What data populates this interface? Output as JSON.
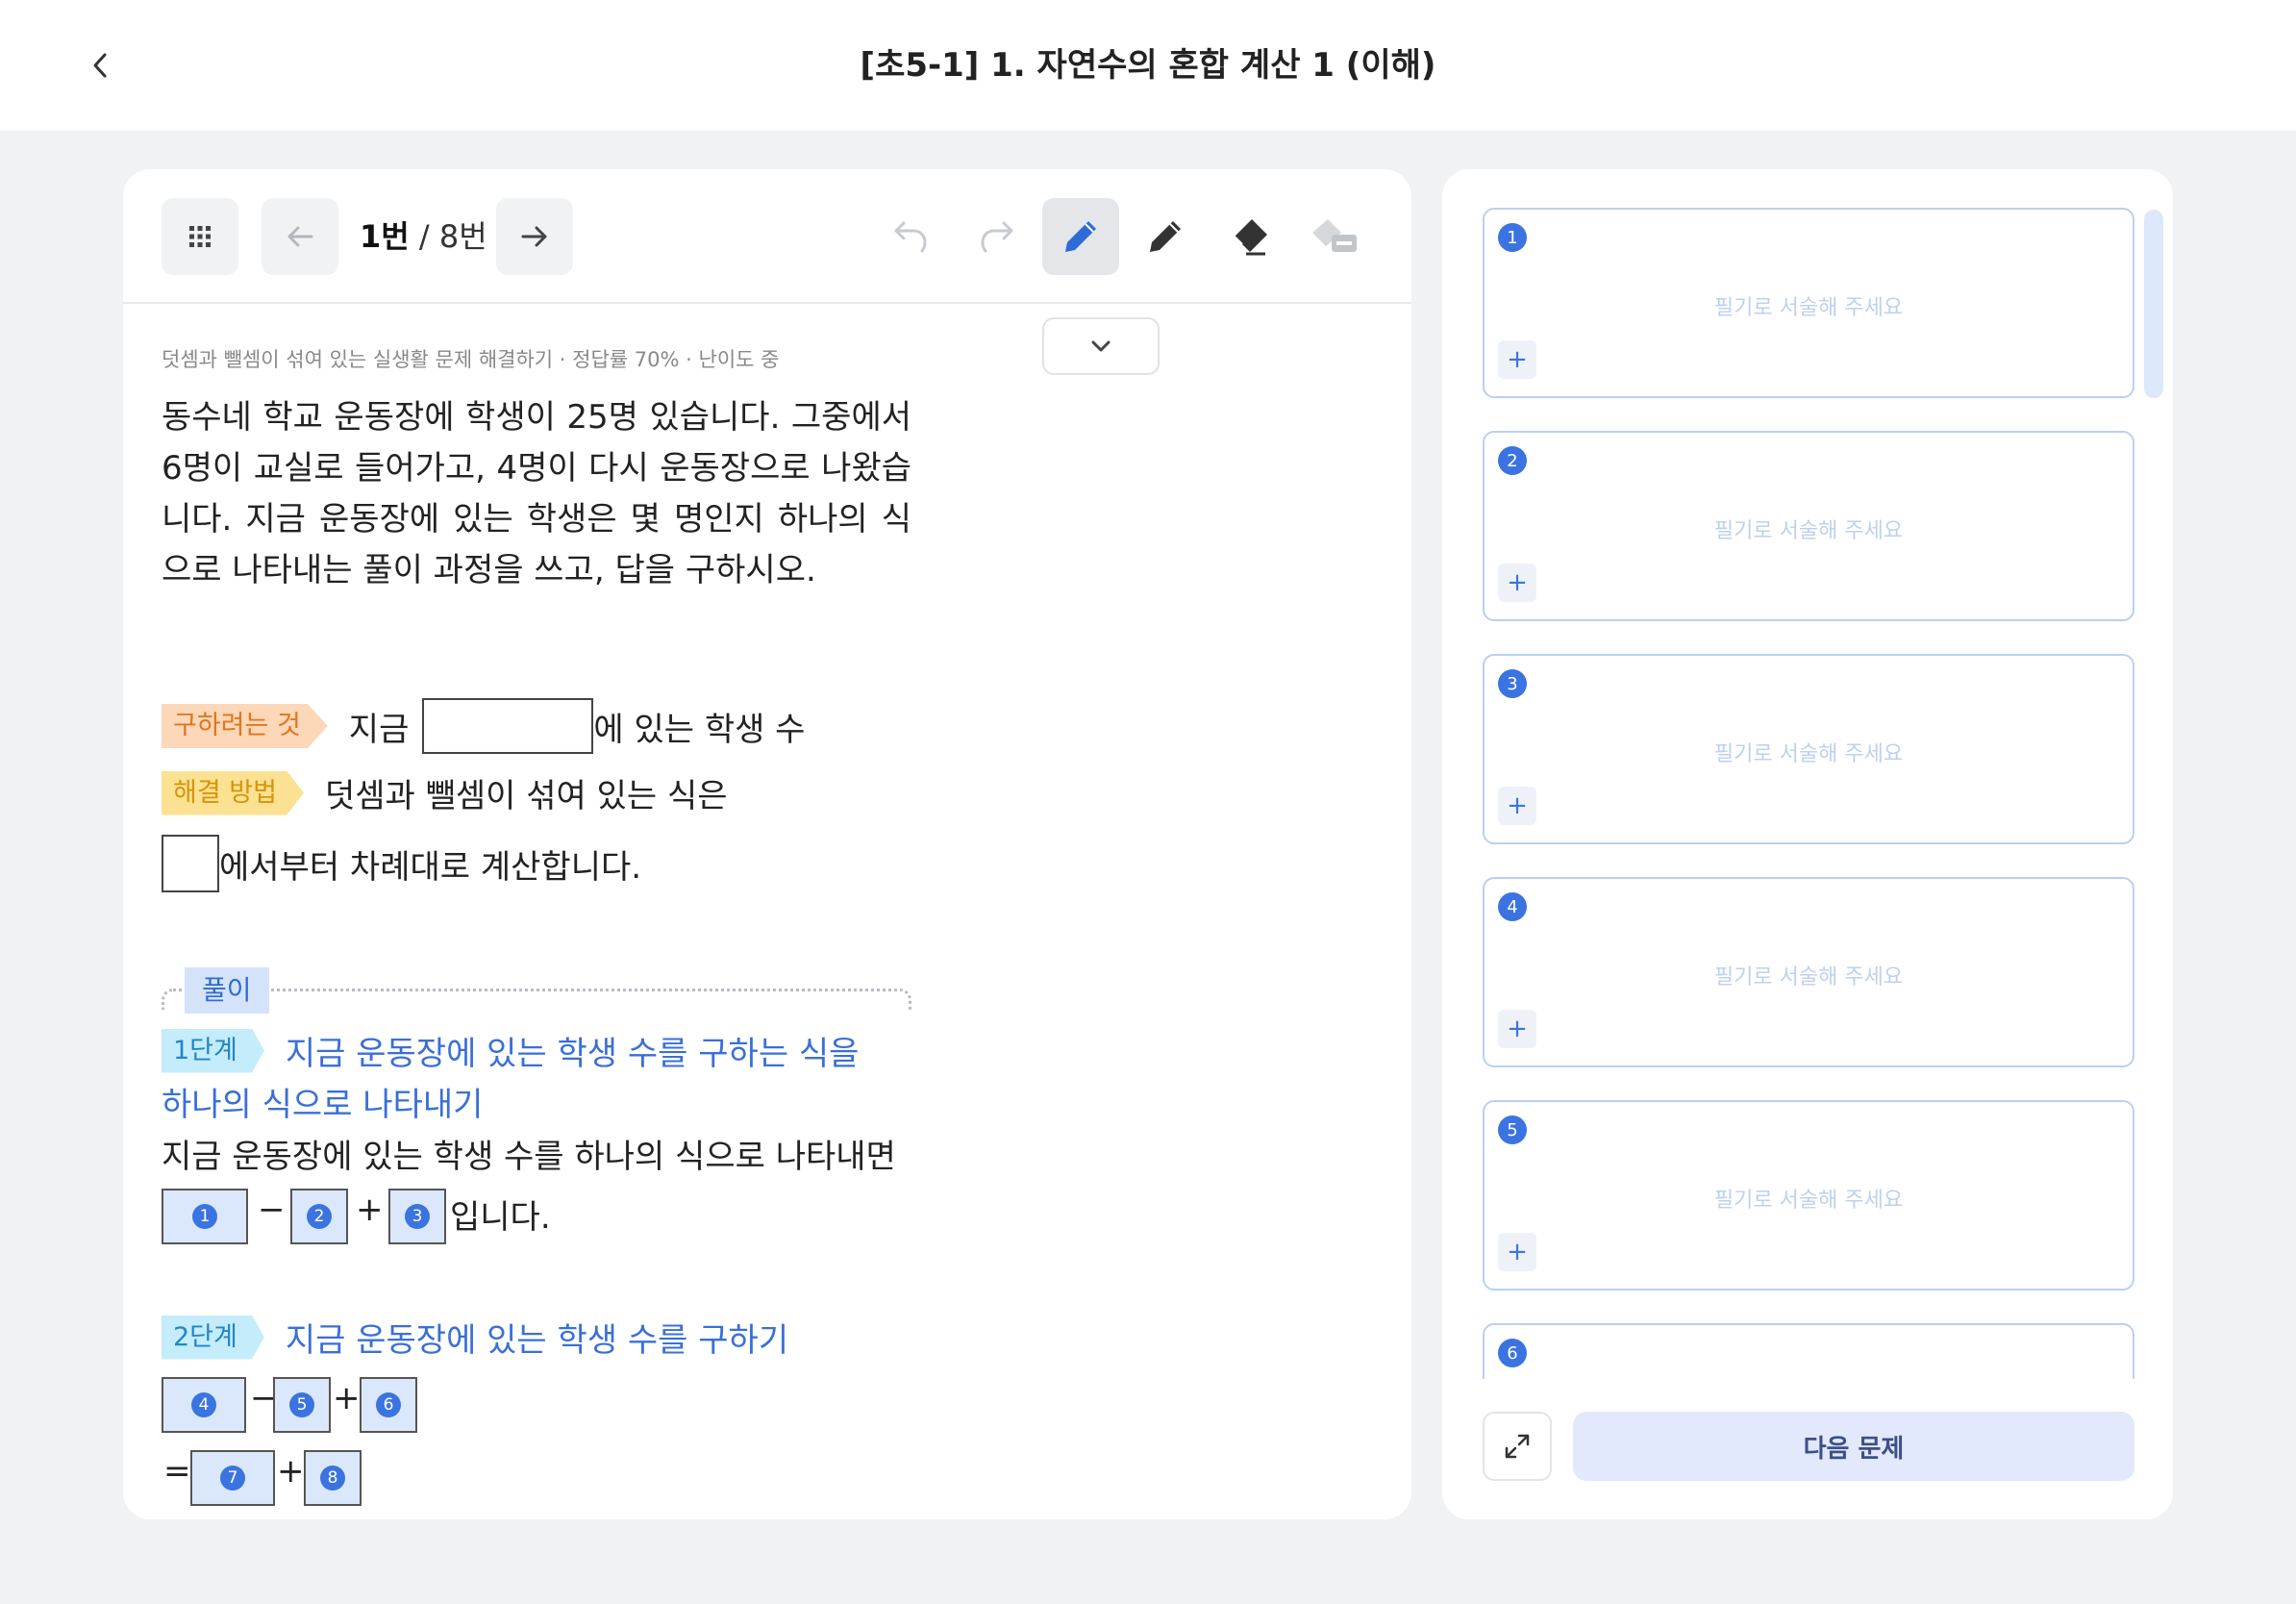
{
  "header": {
    "title": "[초5-1] 1. 자연수의 혼합 계산 1 (이해)"
  },
  "toolbar": {
    "current_page": "1번",
    "separator": " / ",
    "total_pages": "8번"
  },
  "question": {
    "meta": "덧셈과 뺄셈이 섞여 있는 실생활 문제 해결하기 · 정답률 70% · 난이도 중",
    "text": "동수네 학교 운동장에 학생이 25명 있습니다. 그중에서 6명이 교실로 들어가고, 4명이 다시 운동장으로 나왔습니다. 지금 운동장에 있는 학생은 몇 명인지 하나의 식으로 나타내는 풀이 과정을 쓰고, 답을 구하시오."
  },
  "guide": {
    "goal_tag": "구하려는 것",
    "goal_before": "지금",
    "goal_after": "에 있는 학생 수",
    "method_tag": "해결 방법",
    "method_text": "덧셈과 뺄셈이 섞여 있는 식은",
    "method_text2": "에서부터 차례대로 계산합니다."
  },
  "solution": {
    "label": "풀이",
    "step1_tag": "1단계",
    "step1_title": "지금 운동장에 있는 학생 수를 구하는 식을",
    "step1_title2": "하나의 식으로 나타내기",
    "step1_text": "지금 운동장에 있는 학생 수를 하나의 식으로 나타내면",
    "step1_suffix": "입니다.",
    "step2_tag": "2단계",
    "step2_title": "지금 운동장에 있는 학생 수를 구하기",
    "minus": "−",
    "plus": "+",
    "equals": "=",
    "nums": [
      "1",
      "2",
      "3",
      "4",
      "5",
      "6",
      "7",
      "8"
    ]
  },
  "answers": {
    "placeholder": "필기로 서술해 주세요",
    "add": "+",
    "items": [
      "1",
      "2",
      "3",
      "4",
      "5",
      "6"
    ]
  },
  "footer": {
    "next_label": "다음 문제"
  },
  "colors": {
    "accent": "#3b74e0",
    "answer_border": "#b9d0f3",
    "step_title": "#3a6fd8"
  }
}
